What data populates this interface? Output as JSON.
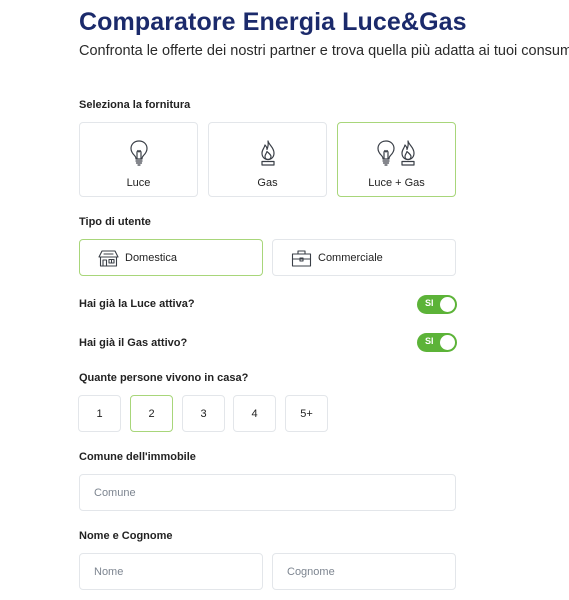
{
  "header": {
    "title": "Comparatore Energia Luce&Gas",
    "subtitle": "Confronta le offerte dei nostri partner e trova quella più adatta ai tuoi consumi"
  },
  "supply": {
    "label": "Seleziona la fornitura",
    "options": [
      {
        "label": "Luce",
        "icon": "lightbulb-icon"
      },
      {
        "label": "Gas",
        "icon": "flame-icon"
      },
      {
        "label": "Luce + Gas",
        "icon": "lightbulb-flame-icon"
      }
    ],
    "selected": "Luce + Gas"
  },
  "user_type": {
    "label": "Tipo di utente",
    "options": [
      {
        "label": "Domestica",
        "icon": "house-icon"
      },
      {
        "label": "Commerciale",
        "icon": "briefcase-icon"
      }
    ],
    "selected": "Domestica"
  },
  "toggles": {
    "luce": {
      "label": "Hai già la Luce attiva?",
      "value": "SI",
      "on": true
    },
    "gas": {
      "label": "Hai già il Gas attivo?",
      "value": "SI",
      "on": true
    }
  },
  "people": {
    "label": "Quante persone vivono in casa?",
    "options": [
      "1",
      "2",
      "3",
      "4",
      "5+"
    ],
    "selected": "2"
  },
  "comune": {
    "label": "Comune dell'immobile",
    "placeholder": "Comune"
  },
  "nome": {
    "label": "Nome e Cognome",
    "first_placeholder": "Nome",
    "last_placeholder": "Cognome"
  },
  "colors": {
    "title": "#1b2a6b",
    "accent_green": "#5cb338",
    "selected_border": "#a8d67a",
    "card_border": "#e3e6ea"
  }
}
